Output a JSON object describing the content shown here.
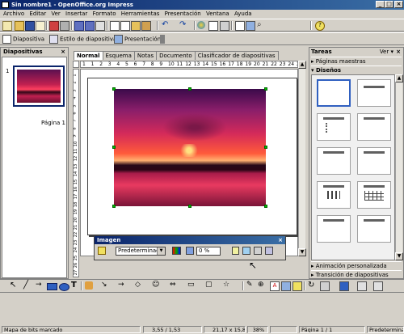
{
  "window": {
    "title": "Sin nombre1 - OpenOffice.org Impress"
  },
  "menu": [
    "Archivo",
    "Editar",
    "Ver",
    "Insertar",
    "Formato",
    "Herramientas",
    "Presentación",
    "Ventana",
    "Ayuda"
  ],
  "toolbar2": {
    "slides": "Diapositiva",
    "style": "Estilo de diapositiva",
    "presentation": "Presentación"
  },
  "left_panel": {
    "title": "Diapositivas",
    "slide_number": "1",
    "slide_label": "Página 1"
  },
  "view_tabs": [
    "Normal",
    "Esquema",
    "Notas",
    "Documento",
    "Clasificador de diapositivas"
  ],
  "ruler": {
    "h_ticks": [
      "1",
      "1",
      "2",
      "3",
      "4",
      "5",
      "6",
      "7",
      "8",
      "9",
      "10",
      "11",
      "12",
      "13",
      "14",
      "15",
      "16",
      "17",
      "18",
      "19",
      "20",
      "21",
      "22",
      "23",
      "24",
      "25"
    ],
    "v_ticks": [
      "1",
      "2",
      "3",
      "4",
      "5",
      "6",
      "7",
      "8",
      "9",
      "10",
      "11",
      "12",
      "13",
      "14",
      "15",
      "16",
      "17",
      "18",
      "19",
      "20",
      "21",
      "22",
      "23",
      "24",
      "25",
      "26",
      "27"
    ]
  },
  "image_toolbar": {
    "title": "Imagen",
    "mode": "Predeterminado",
    "transparency": "0 %"
  },
  "tasks": {
    "title": "Tareas",
    "view_label": "Ver",
    "sections": {
      "masters": "Páginas maestras",
      "layouts": "Diseños",
      "animation": "Animación personalizada",
      "transition": "Transición de diapositivas"
    }
  },
  "status": {
    "mode": "Mapa de bits marcado",
    "position": "3,55 / 1,53",
    "size": "21,17 x 15,87",
    "zoom": "38%",
    "page": "Página 1 / 1",
    "layout": "Predeterminado"
  },
  "colors": {
    "title_bar": "#0a246a",
    "selection_handles": "#00c000",
    "workspace": "#ffffff",
    "chrome": "#d4d0c8"
  }
}
